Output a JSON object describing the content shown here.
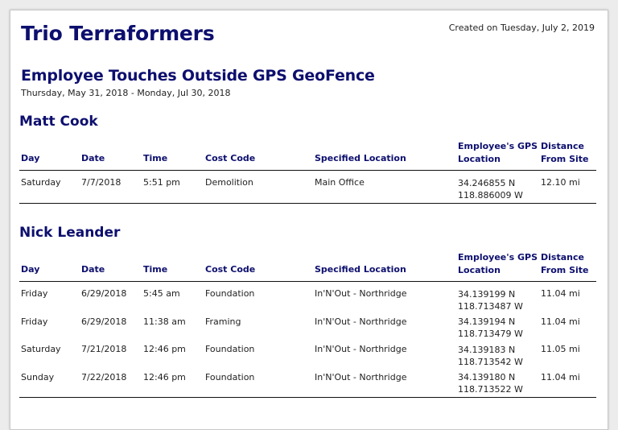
{
  "company": "Trio Terraformers",
  "created": "Created on Tuesday, July 2, 2019",
  "report_title": "Employee Touches Outside GPS GeoFence",
  "date_range": "Thursday, May 31, 2018 - Monday, Jul 30, 2018",
  "columns": {
    "day": "Day",
    "date": "Date",
    "time": "Time",
    "cost_code": "Cost Code",
    "specified_location": "Specified Location",
    "gps_line1": "Employee's GPS",
    "gps_line2": "Location",
    "distance_line1": "Distance",
    "distance_line2": "From Site"
  },
  "employees": [
    {
      "name": "Matt Cook",
      "rows": [
        {
          "day": "Saturday",
          "date": "7/7/2018",
          "time": "5:51 pm",
          "cost_code": "Demolition",
          "location": "Main Office",
          "lat": "34.246855 N",
          "lon": "118.886009 W",
          "distance": "12.10 mi"
        }
      ]
    },
    {
      "name": "Nick Leander",
      "rows": [
        {
          "day": "Friday",
          "date": "6/29/2018",
          "time": "5:45 am",
          "cost_code": "Foundation",
          "location": "In'N'Out - Northridge",
          "lat": "34.139199 N",
          "lon": "118.713487 W",
          "distance": "11.04 mi"
        },
        {
          "day": "Friday",
          "date": "6/29/2018",
          "time": "11:38 am",
          "cost_code": "Framing",
          "location": "In'N'Out - Northridge",
          "lat": "34.139194 N",
          "lon": "118.713479 W",
          "distance": "11.04 mi"
        },
        {
          "day": "Saturday",
          "date": "7/21/2018",
          "time": "12:46 pm",
          "cost_code": "Foundation",
          "location": "In'N'Out - Northridge",
          "lat": "34.139183 N",
          "lon": "118.713542 W",
          "distance": "11.05 mi"
        },
        {
          "day": "Sunday",
          "date": "7/22/2018",
          "time": "12:46 pm",
          "cost_code": "Foundation",
          "location": "In'N'Out - Northridge",
          "lat": "34.139180 N",
          "lon": "118.713522 W",
          "distance": "11.04 mi"
        }
      ]
    }
  ]
}
